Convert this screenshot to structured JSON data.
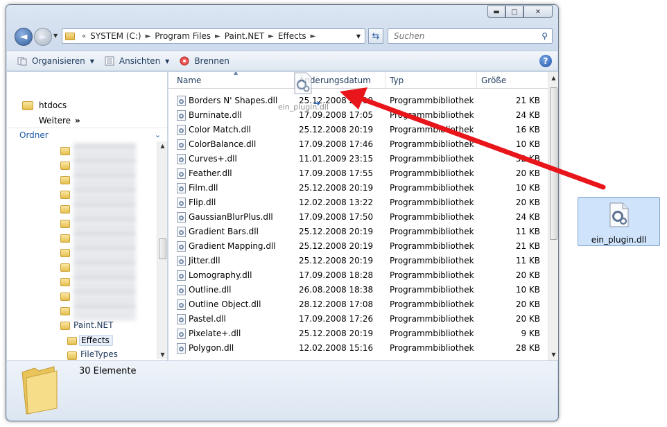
{
  "window": {
    "title_buttons": {
      "minimize": "▬",
      "maximize": "□",
      "close": "✕"
    }
  },
  "address_bar": {
    "overflow": "«",
    "crumbs": [
      "SYSTEM (C:)",
      "Program Files",
      "Paint.NET",
      "Effects"
    ]
  },
  "search": {
    "placeholder": "Suchen"
  },
  "toolbar": {
    "organize": "Organisieren",
    "views": "Ansichten",
    "burn": "Brennen"
  },
  "nav": {
    "favorites": [
      "htdocs"
    ],
    "more": "Weitere",
    "more_chevron": "»",
    "folders_label": "Ordner",
    "tree": {
      "paint_net": "Paint.NET",
      "effects": "Effects",
      "filetypes": "FileTypes"
    }
  },
  "columns": {
    "name": "Name",
    "date": "Änderungsdatum",
    "type": "Typ",
    "size": "Größe"
  },
  "files": [
    {
      "name": "Borders N' Shapes.dll",
      "date": "25.12.2008 20:19",
      "type": "Programmbibliothek",
      "size": "21 KB"
    },
    {
      "name": "Burninate.dll",
      "date": "17.09.2008 17:05",
      "type": "Programmbibliothek",
      "size": "24 KB"
    },
    {
      "name": "Color Match.dll",
      "date": "25.12.2008 20:19",
      "type": "Programmbibliothek",
      "size": "16 KB"
    },
    {
      "name": "ColorBalance.dll",
      "date": "17.09.2008 17:46",
      "type": "Programmbibliothek",
      "size": "10 KB"
    },
    {
      "name": "Curves+.dll",
      "date": "11.01.2009 23:15",
      "type": "Programmbibliothek",
      "size": "52 KB"
    },
    {
      "name": "Feather.dll",
      "date": "17.09.2008 17:55",
      "type": "Programmbibliothek",
      "size": "20 KB"
    },
    {
      "name": "Film.dll",
      "date": "25.12.2008 20:19",
      "type": "Programmbibliothek",
      "size": "10 KB"
    },
    {
      "name": "Flip.dll",
      "date": "12.02.2008 13:22",
      "type": "Programmbibliothek",
      "size": "20 KB"
    },
    {
      "name": "GaussianBlurPlus.dll",
      "date": "17.09.2008 17:50",
      "type": "Programmbibliothek",
      "size": "24 KB"
    },
    {
      "name": "Gradient Bars.dll",
      "date": "25.12.2008 20:19",
      "type": "Programmbibliothek",
      "size": "11 KB"
    },
    {
      "name": "Gradient Mapping.dll",
      "date": "25.12.2008 20:19",
      "type": "Programmbibliothek",
      "size": "21 KB"
    },
    {
      "name": "Jitter.dll",
      "date": "25.12.2008 20:19",
      "type": "Programmbibliothek",
      "size": "11 KB"
    },
    {
      "name": "Lomography.dll",
      "date": "17.09.2008 18:28",
      "type": "Programmbibliothek",
      "size": "20 KB"
    },
    {
      "name": "Outline.dll",
      "date": "26.08.2008 18:38",
      "type": "Programmbibliothek",
      "size": "10 KB"
    },
    {
      "name": "Outline Object.dll",
      "date": "28.12.2008 17:08",
      "type": "Programmbibliothek",
      "size": "20 KB"
    },
    {
      "name": "Pastel.dll",
      "date": "17.09.2008 17:26",
      "type": "Programmbibliothek",
      "size": "20 KB"
    },
    {
      "name": "Pixelate+.dll",
      "date": "25.12.2008 20:19",
      "type": "Programmbibliothek",
      "size": "9 KB"
    },
    {
      "name": "Polygon.dll",
      "date": "12.02.2008 15:16",
      "type": "Programmbibliothek",
      "size": "28 KB"
    }
  ],
  "drag": {
    "ghost_label": "ein_plugin.dll"
  },
  "details": {
    "count": "30 Elemente"
  },
  "desktop_file": {
    "label": "ein_plugin.dll"
  },
  "colors": {
    "accent_blue": "#1d5aa8",
    "selection": "#cfe3fb",
    "arrow": "#e8151b"
  }
}
